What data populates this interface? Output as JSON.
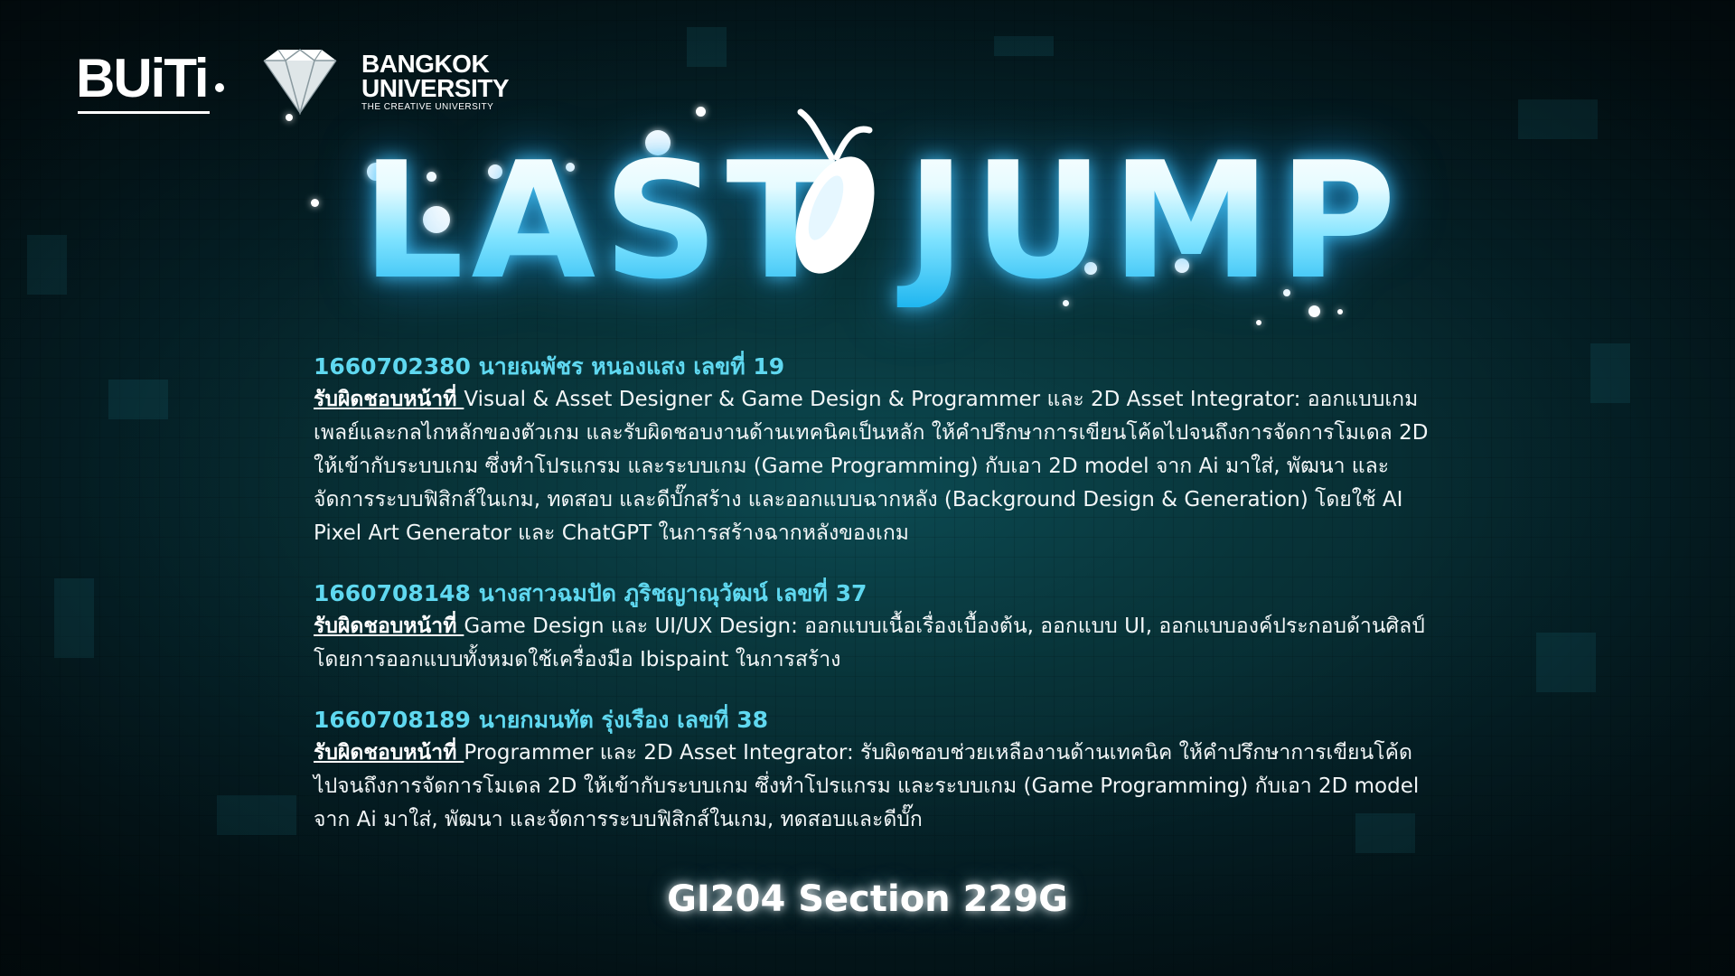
{
  "logos": {
    "buiti": "BUiTi",
    "university_name_line1": "BANGKOK",
    "university_name_line2": "UNIVERSITY",
    "university_tagline": "THE CREATIVE UNIVERSITY"
  },
  "title": {
    "text": "LAST JUMP",
    "glow_color": "#3cc8ff"
  },
  "members": [
    {
      "header": "1660702380 นายณพัชร หนองแสง เลขที่ 19",
      "role_label": "รับผิดชอบหน้าที่ ",
      "description": "Visual & Asset Designer & Game Design & Programmer และ 2D Asset Integrator: ออกแบบเกมเพลย์และกลไกหลักของตัวเกม และรับผิดชอบงานด้านเทคนิคเป็นหลัก ให้คำปรึกษาการเขียนโค้ดไปจนถึงการจัดการโมเดล 2D ให้เข้ากับระบบเกม ซึ่งทำโปรแกรม และระบบเกม (Game Programming) กับเอา 2D model จาก Ai มาใส่, พัฒนา และจัดการระบบฟิสิกส์ในเกม, ทดสอบ และดีบั๊กสร้าง และออกแบบฉากหลัง (Background Design & Generation) โดยใช้ AI Pixel Art Generator และ ChatGPT ในการสร้างฉากหลังของเกม"
    },
    {
      "header": "1660708148 นางสาวฉมปัด ภูริชญาณุวัฒน์ เลขที่ 37",
      "role_label": "รับผิดชอบหน้าที่ ",
      "description": "Game Design และ UI/UX Design: ออกแบบเนื้อเรื่องเบื้องต้น, ออกแบบ UI, ออกแบบองค์ประกอบด้านศิลป์ โดยการออกแบบทั้งหมดใช้เครื่องมือ Ibispaint ในการสร้าง"
    },
    {
      "header": "1660708189 นายกมนทัต รุ่งเรือง เลขที่ 38",
      "role_label": "รับผิดชอบหน้าที่ ",
      "description": "Programmer และ 2D Asset Integrator:  รับผิดชอบช่วยเหลืองานด้านเทคนิค  ให้คำปรึกษาการเขียนโค้ดไปจนถึงการจัดการโมเดล 2D ให้เข้ากับระบบเกม ซึ่งทำโปรแกรม และระบบเกม (Game Programming) กับเอา 2D model จาก Ai มาใส่, พัฒนา และจัดการระบบฟิสิกส์ในเกม, ทดสอบและดีบั๊ก"
    }
  ],
  "footer": {
    "section": "GI204 Section 229G"
  },
  "colors": {
    "header_text": "#5fd8f0",
    "body_text": "#f2f6f7",
    "background": "#083338"
  },
  "icons": {
    "mascot": "mascot-icon",
    "diamond": "diamond-icon"
  }
}
